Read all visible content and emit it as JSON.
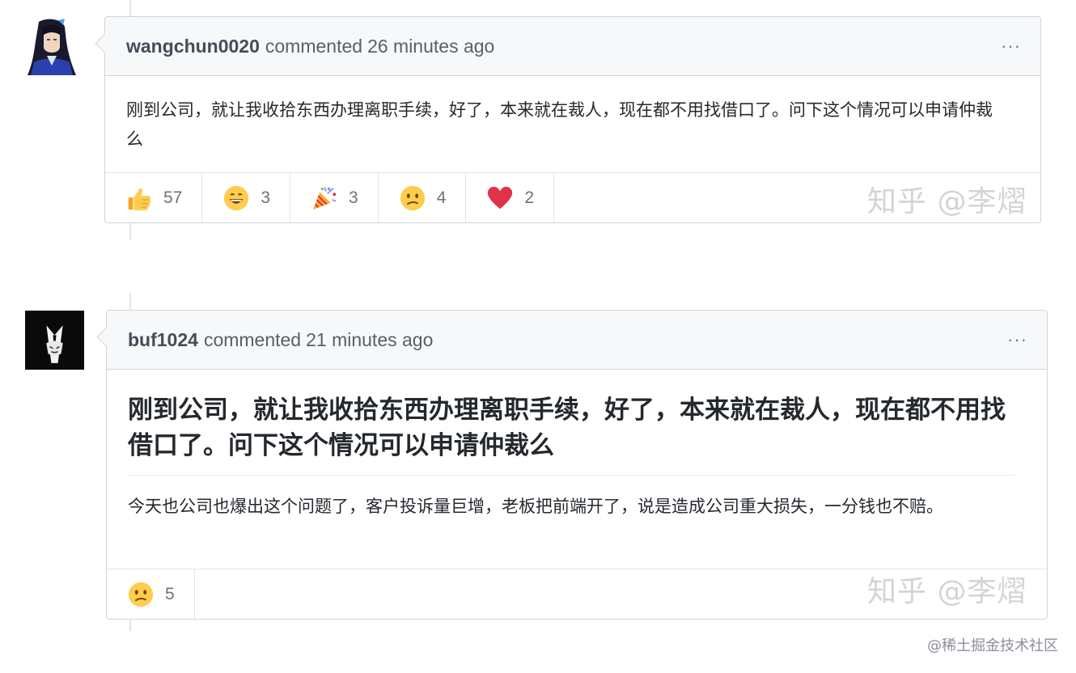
{
  "comments": [
    {
      "author": "wangchun0020",
      "action": "commented",
      "time": "26 minutes ago",
      "avatar_icon": "anime-swordsman-avatar",
      "body": "刚到公司，就让我收拾东西办理离职手续，好了，本来就在裁人，现在都不用找借口了。问下这个情况可以申请仲裁么",
      "reactions": [
        {
          "icon": "thumbs-up-icon",
          "count": "57"
        },
        {
          "icon": "smile-icon",
          "count": "3"
        },
        {
          "icon": "party-popper-icon",
          "count": "3"
        },
        {
          "icon": "confused-icon",
          "count": "4"
        },
        {
          "icon": "heart-icon",
          "count": "2"
        }
      ]
    },
    {
      "author": "buf1024",
      "action": "commented",
      "time": "21 minutes ago",
      "avatar_icon": "black-suit-avatar",
      "quote_heading": "刚到公司，就让我收拾东西办理离职手续，好了，本来就在裁人，现在都不用找借口了。问下这个情况可以申请仲裁么",
      "body": "今天也公司也爆出这个问题了，客户投诉量巨增，老板把前端开了，说是造成公司重大损失，一分钱也不赔。",
      "reactions": [
        {
          "icon": "confused-icon",
          "count": "5"
        }
      ]
    }
  ],
  "watermark_text": "知乎 @李熠",
  "site_mark": "@稀土掘金技术社区",
  "kebab_label": "···",
  "colors": {
    "header_bg": "#f6f8fa",
    "border": "#d1d5da",
    "muted_text": "#586069",
    "heart": "#e0334a",
    "emoji_yellow": "#ffcc4d"
  }
}
